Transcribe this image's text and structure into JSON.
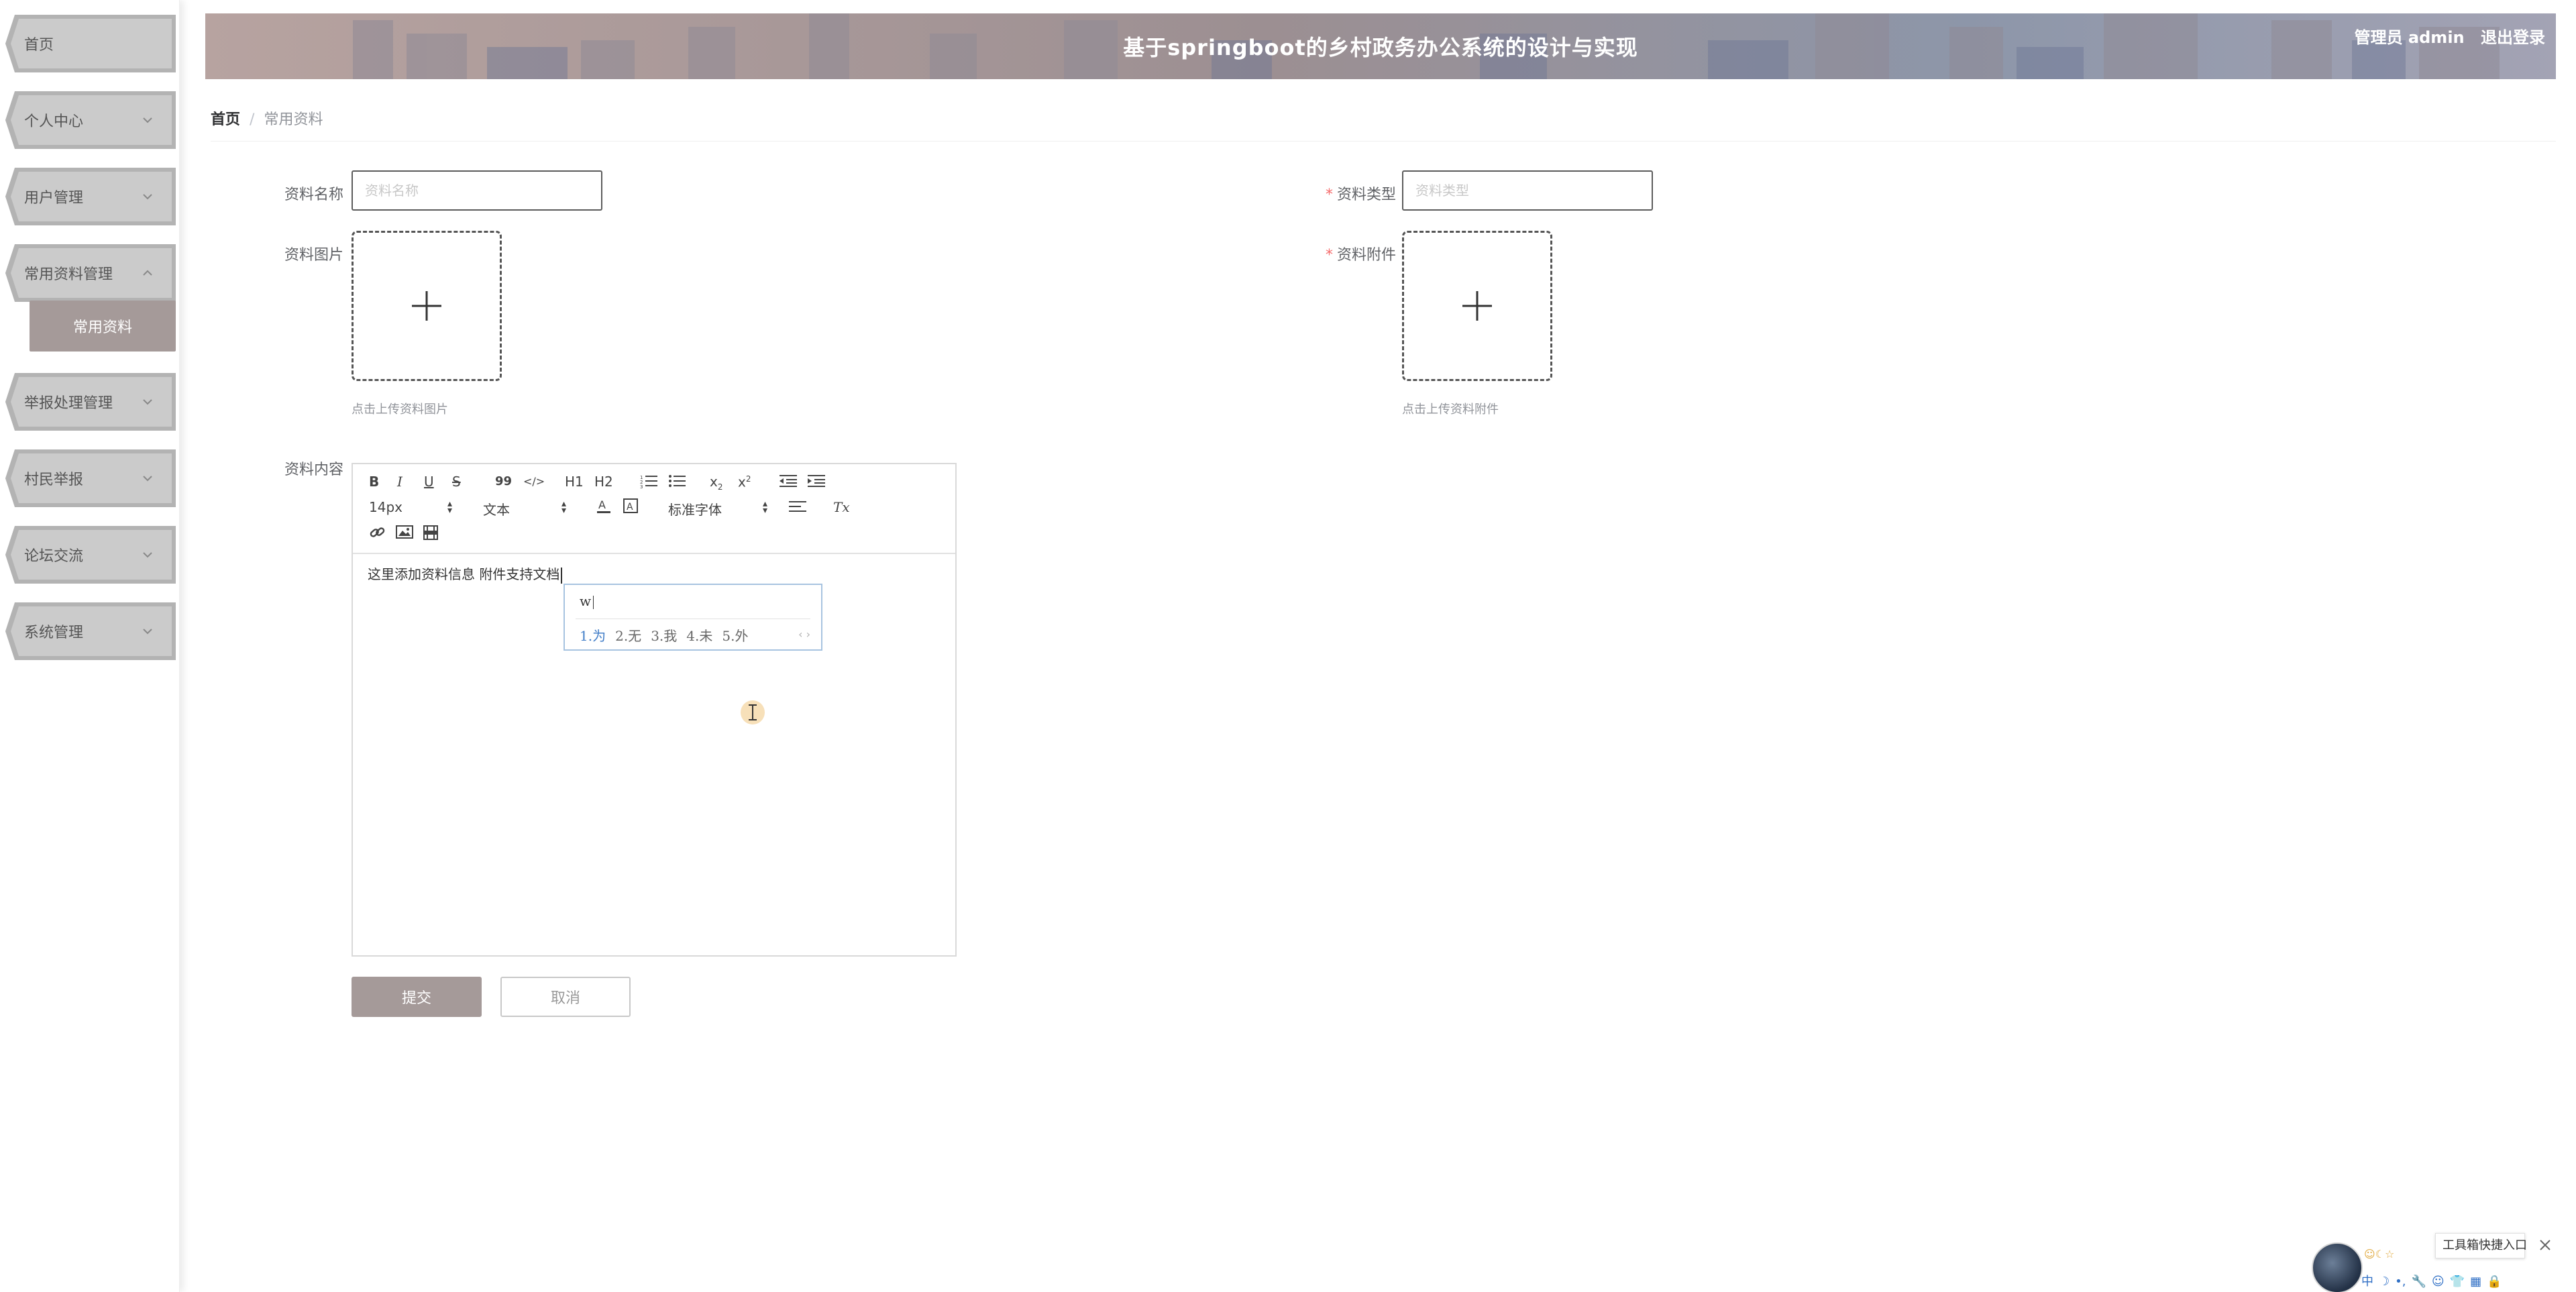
{
  "header": {
    "title": "基于springboot的乡村政务办公系统的设计与实现",
    "user": "管理员 admin",
    "logout": "退出登录"
  },
  "sidebar": {
    "items": [
      {
        "label": "首页",
        "has_chevron": false
      },
      {
        "label": "个人中心",
        "has_chevron": true
      },
      {
        "label": "用户管理",
        "has_chevron": true
      },
      {
        "label": "常用资料管理",
        "has_chevron": true,
        "expanded": true
      },
      {
        "label": "举报处理管理",
        "has_chevron": true
      },
      {
        "label": "村民举报",
        "has_chevron": true
      },
      {
        "label": "论坛交流",
        "has_chevron": true
      },
      {
        "label": "系统管理",
        "has_chevron": true
      }
    ],
    "submenu": {
      "label": "常用资料"
    },
    "colors": {
      "plate": "#c8c8c8",
      "active": "#a59a99"
    }
  },
  "breadcrumb": {
    "home": "首页",
    "separator": "/",
    "current": "常用资料"
  },
  "form": {
    "name": {
      "label": "资料名称",
      "placeholder": "资料名称",
      "value": ""
    },
    "type": {
      "label": "资料类型",
      "required_mark": "*",
      "placeholder": "资料类型",
      "value": ""
    },
    "image": {
      "label": "资料图片",
      "hint": "点击上传资料图片"
    },
    "attachment": {
      "label": "资料附件",
      "required_mark": "*",
      "hint": "点击上传资料附件"
    },
    "content": {
      "label": "资料内容",
      "text": "这里添加资料信息 附件支持文档"
    }
  },
  "editor": {
    "toolbar": {
      "bold": "B",
      "italic": "I",
      "underline": "U",
      "strike": "S",
      "quote": "99",
      "code": "</>",
      "h1": "H1",
      "h2": "H2",
      "font_size": "14px",
      "paragraph": "文本",
      "font_family": "标准字体",
      "clear_format": "Tx"
    }
  },
  "ime": {
    "input": "w",
    "candidates": [
      "1.为",
      "2.无",
      "3.我",
      "4.未",
      "5.外"
    ],
    "arrows": "‹ ›"
  },
  "buttons": {
    "submit": "提交",
    "cancel": "取消"
  },
  "widget": {
    "toolbox": "工具箱快捷入口",
    "ime_bar": [
      "中",
      "☽",
      "•,",
      "🔧",
      "☺",
      "👕",
      "▦",
      "🔒"
    ]
  },
  "colors": {
    "accent": "#a59a99",
    "required": "#f56c6c"
  }
}
